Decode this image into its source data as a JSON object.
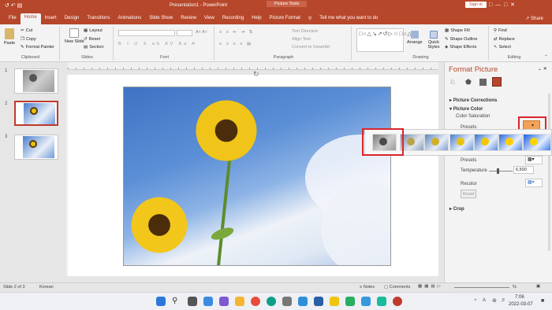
{
  "window": {
    "title": "Presentation1 - PowerPoint",
    "context_label": "Picture Tools",
    "signin": "Sign in"
  },
  "tabs": [
    "File",
    "Home",
    "Insert",
    "Design",
    "Transitions",
    "Animations",
    "Slide Show",
    "Review",
    "View",
    "Recording",
    "Help",
    "Picture Format"
  ],
  "tell_me": "Tell me what you want to do",
  "share": "Share",
  "ribbon": {
    "clipboard": {
      "paste": "Paste",
      "cut": "Cut",
      "copy": "Copy",
      "format_painter": "Format Painter",
      "label": "Clipboard"
    },
    "slides": {
      "new_slide": "New Slide",
      "layout": "Layout",
      "reset": "Reset",
      "section": "Section",
      "label": "Slides"
    },
    "font": {
      "label": "Font"
    },
    "paragraph": {
      "text_direction": "Text Direction",
      "align_text": "Align Text",
      "convert_smartart": "Convert to SmartArt",
      "label": "Paragraph"
    },
    "drawing": {
      "arrange": "Arrange",
      "quick_styles": "Quick Styles",
      "shape_fill": "Shape Fill",
      "shape_outline": "Shape Outline",
      "shape_effects": "Shape Effects",
      "label": "Drawing"
    },
    "editing": {
      "find": "Find",
      "replace": "Replace",
      "select": "Select",
      "label": "Editing"
    }
  },
  "slides": [
    {
      "num": "1"
    },
    {
      "num": "2"
    },
    {
      "num": "3"
    }
  ],
  "pane": {
    "title": "Format Picture",
    "picture_corrections": "Picture Corrections",
    "picture_color": "Picture Color",
    "color_saturation": "Color Saturation",
    "presets": "Presets",
    "color_tone": "Presets",
    "temperature": "Temperature",
    "temperature_value": "6,500",
    "recolor": "Recolor",
    "reset": "Reset",
    "crop": "Crop"
  },
  "status": {
    "slide_info": "Slide 2 of 3",
    "language": "Korean",
    "notes": "Notes",
    "comments": "Comments"
  },
  "taskbar": {
    "time": "7:06",
    "date": "2022-03-07",
    "lang": "A"
  },
  "colors": {
    "accent": "#b7472a",
    "highlight": "#d9252a",
    "sky": "#4a7ecb"
  }
}
